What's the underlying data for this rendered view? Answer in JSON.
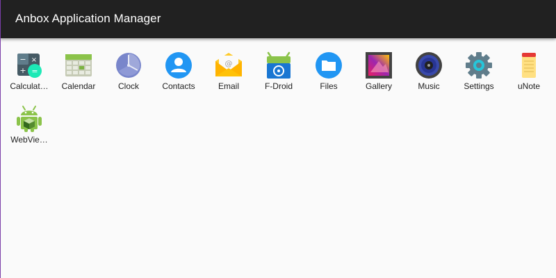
{
  "window": {
    "title": "Anbox Application Manager"
  },
  "apps": [
    {
      "label": "Calculat…",
      "icon": "calculator-icon"
    },
    {
      "label": "Calendar",
      "icon": "calendar-icon"
    },
    {
      "label": "Clock",
      "icon": "clock-icon"
    },
    {
      "label": "Contacts",
      "icon": "contacts-icon"
    },
    {
      "label": "Email",
      "icon": "email-icon"
    },
    {
      "label": "F-Droid",
      "icon": "fdroid-icon"
    },
    {
      "label": "Files",
      "icon": "files-icon"
    },
    {
      "label": "Gallery",
      "icon": "gallery-icon"
    },
    {
      "label": "Music",
      "icon": "music-icon"
    },
    {
      "label": "Settings",
      "icon": "settings-icon"
    },
    {
      "label": "uNote",
      "icon": "unote-icon"
    },
    {
      "label": "WebVie…",
      "icon": "webview-icon"
    }
  ],
  "colors": {
    "titlebar": "#212121",
    "background": "#fafafa",
    "label": "#212121"
  }
}
